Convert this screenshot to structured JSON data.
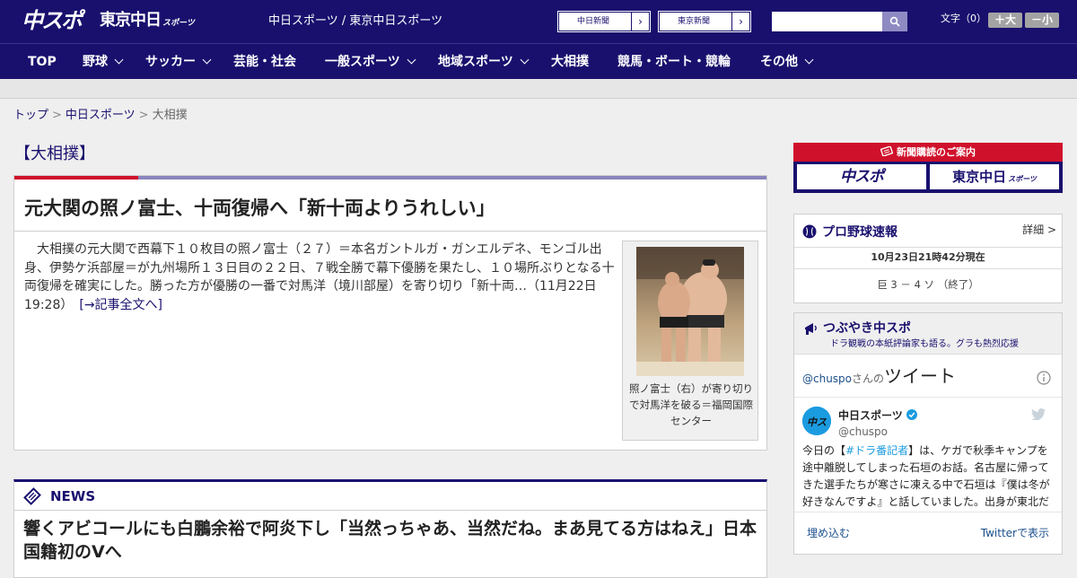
{
  "header": {
    "logo_chuspo": "中スポ",
    "logo_tokyo": "東京中日",
    "logo_tokyo_small": "スポーツ",
    "site_name": "中日スポーツ / 東京中日スポーツ",
    "link_chunichi": "中日新聞",
    "link_tokyo": "東京新聞",
    "arrow": "›",
    "search_placeholder": "",
    "font_size_label": "文字（0）",
    "font_larger": "＋大",
    "font_smaller": "－小"
  },
  "nav": {
    "items": [
      {
        "label": "TOP"
      },
      {
        "label": "野球"
      },
      {
        "label": "サッカー"
      },
      {
        "label": "芸能・社会"
      },
      {
        "label": "一般スポーツ"
      },
      {
        "label": "地域スポーツ"
      },
      {
        "label": "大相撲"
      },
      {
        "label": "競馬・ボート・競輪"
      },
      {
        "label": "その他"
      }
    ]
  },
  "breadcrumb": {
    "top": "トップ",
    "sep": ">",
    "section": "中日スポーツ",
    "current": "大相撲"
  },
  "category_title": "【大相撲】",
  "article": {
    "headline": "元大関の照ノ富士、十両復帰へ「新十両よりうれしい」",
    "body": "　大相撲の元大関で西幕下１０枚目の照ノ富士（２７）＝本名ガントルガ・ガンエルデネ、モンゴル出身、伊勢ケ浜部屋＝が九州場所１３日目の２２日、７戦全勝で幕下優勝を果たし、１０場所ぶりとなる十両復帰を確実にした。勝った方が優勝の一番で対馬洋（境川部屋）を寄り切り「新十両…（11月22日 19:28）　",
    "more_link": "[→記事全文へ]",
    "photo_caption": "照ノ富士（右）が寄り切りで対馬洋を破る＝福岡国際センター"
  },
  "news": {
    "section_title": "NEWS",
    "headline": "響くアビコールにも白鵬余裕で阿炎下し「当然っちゃあ、当然だね。まあ見てる方はねえ」日本国籍初のVへ"
  },
  "sidebar": {
    "subscribe_title": "新聞購読のご案内",
    "subscribe_chuspo": "中スポ",
    "subscribe_tokyo": "東京中日",
    "subscribe_tokyo_small": "スポーツ",
    "baseball": {
      "title": "プロ野球速報",
      "detail": "詳細 >",
      "time": "10月23日21時42分現在",
      "score": "巨  3 － 4  ソ  （終了）"
    },
    "tweets": {
      "title": "つぶやき中スポ",
      "subtitle": "ドラ観戦の本紙評論家も語る。グラも熱烈応援",
      "handle_prefix": "@chuspo",
      "handle_suffix": "さんの",
      "tweets_word": "ツイート",
      "name": "中日スポーツ",
      "handle": "@chuspo",
      "text_pre": "今日の【",
      "text_tag": "#ドラ番記者",
      "text_post": "】は、ケガで秋季キャンプを途中離脱してしまった石垣のお話。名古屋に帰ってきた選手たちが寒さに凍える中で石垣は『僕は冬が好きなんですよ』と話していました。出身が東北だからなのかな？",
      "embed": "埋め込む",
      "view_on": "Twitterで表示"
    }
  },
  "colors": {
    "brand_navy": "#19106e",
    "accent_red": "#d0112b",
    "twitter_blue": "#1b9be0"
  }
}
